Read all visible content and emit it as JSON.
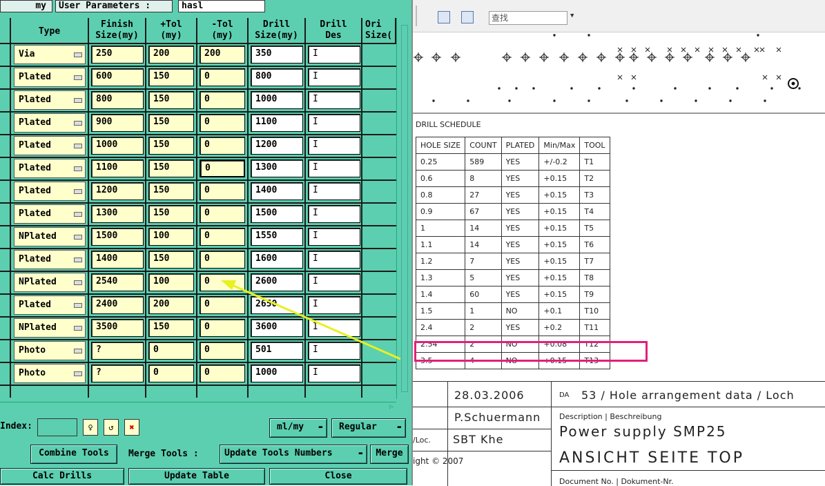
{
  "left_panel": {
    "top": {
      "box1": "my",
      "box2_label": "User Parameters :",
      "box3_value": "hasl"
    },
    "headers": [
      "Type",
      "Finish\nSize(my)",
      "+Tol\n(my)",
      "-Tol\n(my)",
      "Drill\nSize(my)",
      "Drill\nDes",
      "Ori\nSize("
    ],
    "rows": [
      {
        "type": "Via",
        "finish": "250",
        "ptol": "200",
        "ntol": "200",
        "drill": "350"
      },
      {
        "type": "Plated",
        "finish": "600",
        "ptol": "150",
        "ntol": "0",
        "drill": "800"
      },
      {
        "type": "Plated",
        "finish": "800",
        "ptol": "150",
        "ntol": "0",
        "drill": "1000"
      },
      {
        "type": "Plated",
        "finish": "900",
        "ptol": "150",
        "ntol": "0",
        "drill": "1100"
      },
      {
        "type": "Plated",
        "finish": "1000",
        "ptol": "150",
        "ntol": "0",
        "drill": "1200"
      },
      {
        "type": "Plated",
        "finish": "1100",
        "ptol": "150",
        "ntol": "0",
        "drill": "1300"
      },
      {
        "type": "Plated",
        "finish": "1200",
        "ptol": "150",
        "ntol": "0",
        "drill": "1400"
      },
      {
        "type": "Plated",
        "finish": "1300",
        "ptol": "150",
        "ntol": "0",
        "drill": "1500"
      },
      {
        "type": "NPlated",
        "finish": "1500",
        "ptol": "100",
        "ntol": "0",
        "drill": "1550"
      },
      {
        "type": "Plated",
        "finish": "1400",
        "ptol": "150",
        "ntol": "0",
        "drill": "1600"
      },
      {
        "type": "NPlated",
        "finish": "2540",
        "ptol": "100",
        "ntol": "0",
        "drill": "2600"
      },
      {
        "type": "Plated",
        "finish": "2400",
        "ptol": "200",
        "ntol": "0",
        "drill": "2650"
      },
      {
        "type": "NPlated",
        "finish": "3500",
        "ptol": "150",
        "ntol": "0",
        "drill": "3600"
      },
      {
        "type": "Photo",
        "finish": "?",
        "ptol": "0",
        "ntol": "0",
        "drill": "501"
      },
      {
        "type": "Photo",
        "finish": "?",
        "ptol": "0",
        "ntol": "0",
        "drill": "1000"
      }
    ],
    "index_label": "Index:",
    "unit_select": "ml/my",
    "mode_select": "Regular",
    "buttons": {
      "combine_tools": "Combine Tools",
      "merge_tools_label": "Merge Tools :",
      "update_tools_numbers": "Update Tools Numbers",
      "merge": "Merge",
      "calc_drills": "Calc Drills",
      "update_table": "Update Table",
      "close": "Close"
    }
  },
  "right_panel": {
    "search_placeholder": "查找",
    "drill_schedule_title": "DRILL SCHEDULE",
    "table_headers": [
      "HOLE SIZE",
      "COUNT",
      "PLATED",
      "Min/Max",
      "TOOL"
    ],
    "table_rows": [
      [
        "0.25",
        "589",
        "YES",
        "+/-0.2",
        "T1"
      ],
      [
        "0.6",
        "8",
        "YES",
        "+0.15",
        "T2"
      ],
      [
        "0.8",
        "27",
        "YES",
        "+0.15",
        "T3"
      ],
      [
        "0.9",
        "67",
        "YES",
        "+0.15",
        "T4"
      ],
      [
        "1",
        "14",
        "YES",
        "+0.15",
        "T5"
      ],
      [
        "1.1",
        "14",
        "YES",
        "+0.15",
        "T6"
      ],
      [
        "1.2",
        "7",
        "YES",
        "+0.15",
        "T7"
      ],
      [
        "1.3",
        "5",
        "YES",
        "+0.15",
        "T8"
      ],
      [
        "1.4",
        "60",
        "YES",
        "+0.15",
        "T9"
      ],
      [
        "1.5",
        "1",
        "NO",
        "+0.1",
        "T10"
      ],
      [
        "2.4",
        "2",
        "YES",
        "+0.2",
        "T11"
      ],
      [
        "2.54",
        "2",
        "NO",
        "+0.08",
        "T12"
      ],
      [
        "3.5",
        "4",
        "NO",
        "+0.15",
        "T13"
      ]
    ],
    "title_block": {
      "date": "28.03.2006",
      "da_label": "DA",
      "da_text": "53 / Hole arrangement data / Loch",
      "author": "P.Schuermann",
      "desc_label": "Description | Beschreibung",
      "desc": "Power supply SMP25",
      "loc_label": "/Loc.",
      "loc": "SBT Khe",
      "view": "ANSICHT SEITE TOP",
      "copyright": "ight © 2007",
      "docno": "Document No. | Dokument-Nr."
    },
    "colors": {
      "highlight": "#e0207a",
      "arrow": "#e8f020"
    }
  }
}
